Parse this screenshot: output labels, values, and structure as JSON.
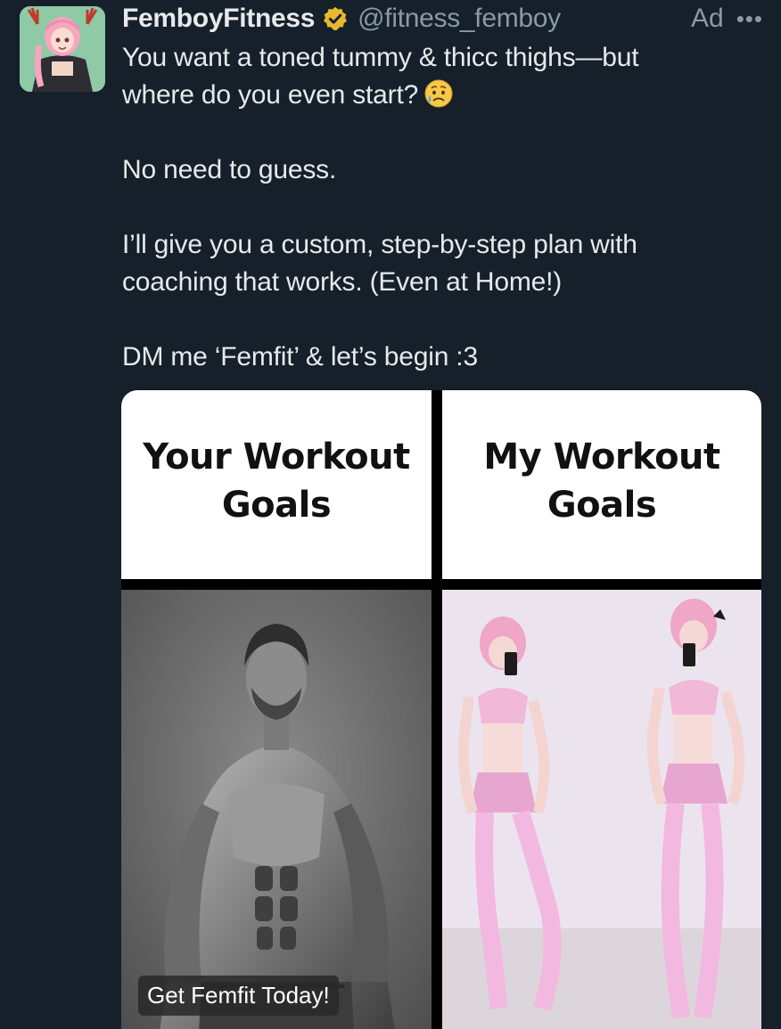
{
  "post": {
    "display_name": "FemboyFitness",
    "handle": "@fitness_femboy",
    "ad_label": "Ad",
    "more_label": "•••",
    "text_line1": "You want a toned tummy & thicc thighs—but",
    "text_line2": "where do you even start?",
    "text_para2": "No need to guess.",
    "text_para3_line1": "I’ll give you a custom, step-by-step plan with",
    "text_para3_line2": "coaching that works. (Even at Home!)",
    "text_para4": "DM me ‘Femfit’ & let’s begin :3"
  },
  "media": {
    "left_title_line1": "Your Workout",
    "left_title_line2": "Goals",
    "right_title_line1": "My Workout",
    "right_title_line2": "Goals",
    "cta_label": "Get Femfit Today!"
  },
  "icons": {
    "verified": "verified-badge-icon",
    "emoji": "sad-sweat-face-emoji",
    "more": "more-dots-icon"
  },
  "colors": {
    "background": "#15202b",
    "name": "#e7e9ea",
    "secondary": "#8b98a5",
    "verified_gold": "#e8b830"
  }
}
